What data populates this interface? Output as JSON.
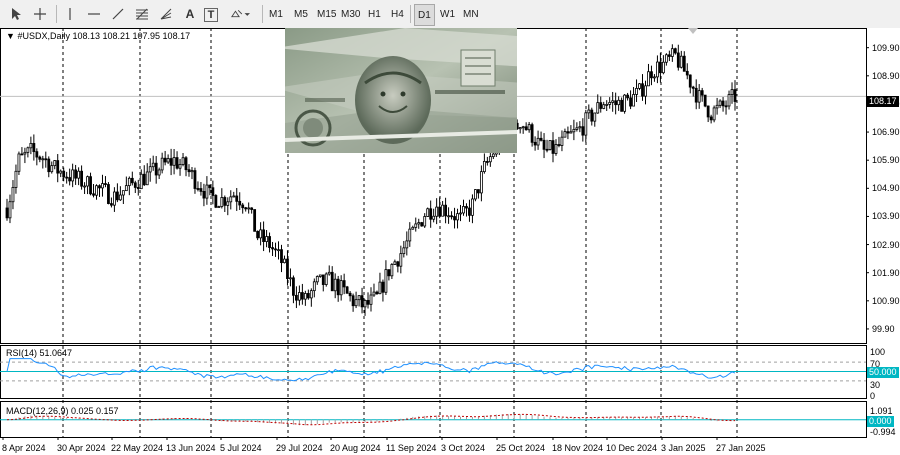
{
  "toolbar": {
    "tools": [
      {
        "name": "cursor-icon"
      },
      {
        "name": "crosshair-icon"
      },
      {
        "name": "vertical-line-icon"
      },
      {
        "name": "horizontal-line-icon"
      },
      {
        "name": "trendline-icon"
      },
      {
        "name": "fibonacci-icon"
      },
      {
        "name": "text-icon",
        "glyph": "A"
      },
      {
        "name": "text-label-icon",
        "glyph": "T"
      },
      {
        "name": "shapes-icon"
      }
    ],
    "timeframes": [
      "M1",
      "M5",
      "M15",
      "M30",
      "H1",
      "H4",
      "D1",
      "W1",
      "MN"
    ],
    "active_timeframe": "D1"
  },
  "chart": {
    "symbol_label": "#USDX,Daily",
    "ohlc": "108.13 108.21 107.95 108.17",
    "current_price": "108.17",
    "price_axis": [
      "109.90",
      "108.90",
      "107.90",
      "106.90",
      "105.90",
      "104.90",
      "103.90",
      "102.90",
      "101.90",
      "100.90",
      "99.90"
    ],
    "dates": [
      "8 Apr 2024",
      "30 Apr 2024",
      "22 May 2024",
      "13 Jun 2024",
      "5 Jul 2024",
      "29 Jul 2024",
      "20 Aug 2024",
      "11 Sep 2024",
      "3 Oct 2024",
      "25 Oct 2024",
      "18 Nov 2024",
      "10 Dec 2024",
      "3 Jan 2025",
      "27 Jan 2025"
    ],
    "candle_color": "#000000",
    "grid_color": "#000000"
  },
  "rsi": {
    "label": "RSI(14) 51.0647",
    "levels": [
      "100",
      "70",
      "50.000",
      "30",
      "0"
    ],
    "line_color": "#1e90ff",
    "level_color": "#00b7c3"
  },
  "macd": {
    "label": "MACD(12,26,9) 0.025 0.157",
    "levels": [
      "1.091",
      "0.000",
      "-0.994"
    ],
    "signal_color": "#c00000",
    "histogram_color": "#a0a0a0"
  },
  "chart_data": {
    "type": "candlestick",
    "title": "#USDX,Daily",
    "ylim": [
      99.4,
      110.6
    ],
    "x": [
      "8 Apr 2024",
      "30 Apr 2024",
      "22 May 2024",
      "13 Jun 2024",
      "5 Jul 2024",
      "29 Jul 2024",
      "20 Aug 2024",
      "11 Sep 2024",
      "3 Oct 2024",
      "25 Oct 2024",
      "18 Nov 2024",
      "10 Dec 2024",
      "3 Jan 2025",
      "27 Jan 2025"
    ],
    "close_path": [
      [
        0,
        104.2
      ],
      [
        2,
        105.9
      ],
      [
        4,
        106.2
      ],
      [
        6,
        106.0
      ],
      [
        8,
        105.6
      ],
      [
        10,
        105.4
      ],
      [
        12,
        105.2
      ],
      [
        14,
        105.0
      ],
      [
        16,
        104.8
      ],
      [
        18,
        104.6
      ],
      [
        20,
        104.9
      ],
      [
        22,
        105.2
      ],
      [
        24,
        105.4
      ],
      [
        26,
        105.7
      ],
      [
        28,
        105.9
      ],
      [
        30,
        105.6
      ],
      [
        32,
        105.1
      ],
      [
        34,
        104.6
      ],
      [
        36,
        104.5
      ],
      [
        38,
        104.7
      ],
      [
        40,
        104.4
      ],
      [
        42,
        103.2
      ],
      [
        44,
        102.9
      ],
      [
        46,
        102.3
      ],
      [
        48,
        101.3
      ],
      [
        50,
        100.9
      ],
      [
        52,
        101.5
      ],
      [
        54,
        101.6
      ],
      [
        56,
        101.3
      ],
      [
        58,
        100.9
      ],
      [
        60,
        100.7
      ],
      [
        62,
        101.0
      ],
      [
        64,
        102.0
      ],
      [
        66,
        102.6
      ],
      [
        68,
        103.3
      ],
      [
        70,
        104.0
      ],
      [
        72,
        104.3
      ],
      [
        74,
        104.1
      ],
      [
        76,
        103.8
      ],
      [
        78,
        104.3
      ],
      [
        80,
        105.6
      ],
      [
        82,
        106.4
      ],
      [
        84,
        106.6
      ],
      [
        86,
        107.3
      ],
      [
        88,
        106.8
      ],
      [
        90,
        106.2
      ],
      [
        92,
        106.3
      ],
      [
        94,
        106.7
      ],
      [
        96,
        107.0
      ],
      [
        98,
        107.5
      ],
      [
        100,
        108.0
      ],
      [
        102,
        107.9
      ],
      [
        104,
        108.0
      ],
      [
        106,
        108.3
      ],
      [
        108,
        109.1
      ],
      [
        110,
        109.3
      ],
      [
        112,
        109.6
      ],
      [
        114,
        108.9
      ],
      [
        116,
        108.1
      ],
      [
        118,
        107.6
      ],
      [
        120,
        107.8
      ],
      [
        122,
        108.17
      ]
    ],
    "rsi_ylim": [
      0,
      100
    ],
    "macd_ylim": [
      -0.994,
      1.091
    ]
  }
}
